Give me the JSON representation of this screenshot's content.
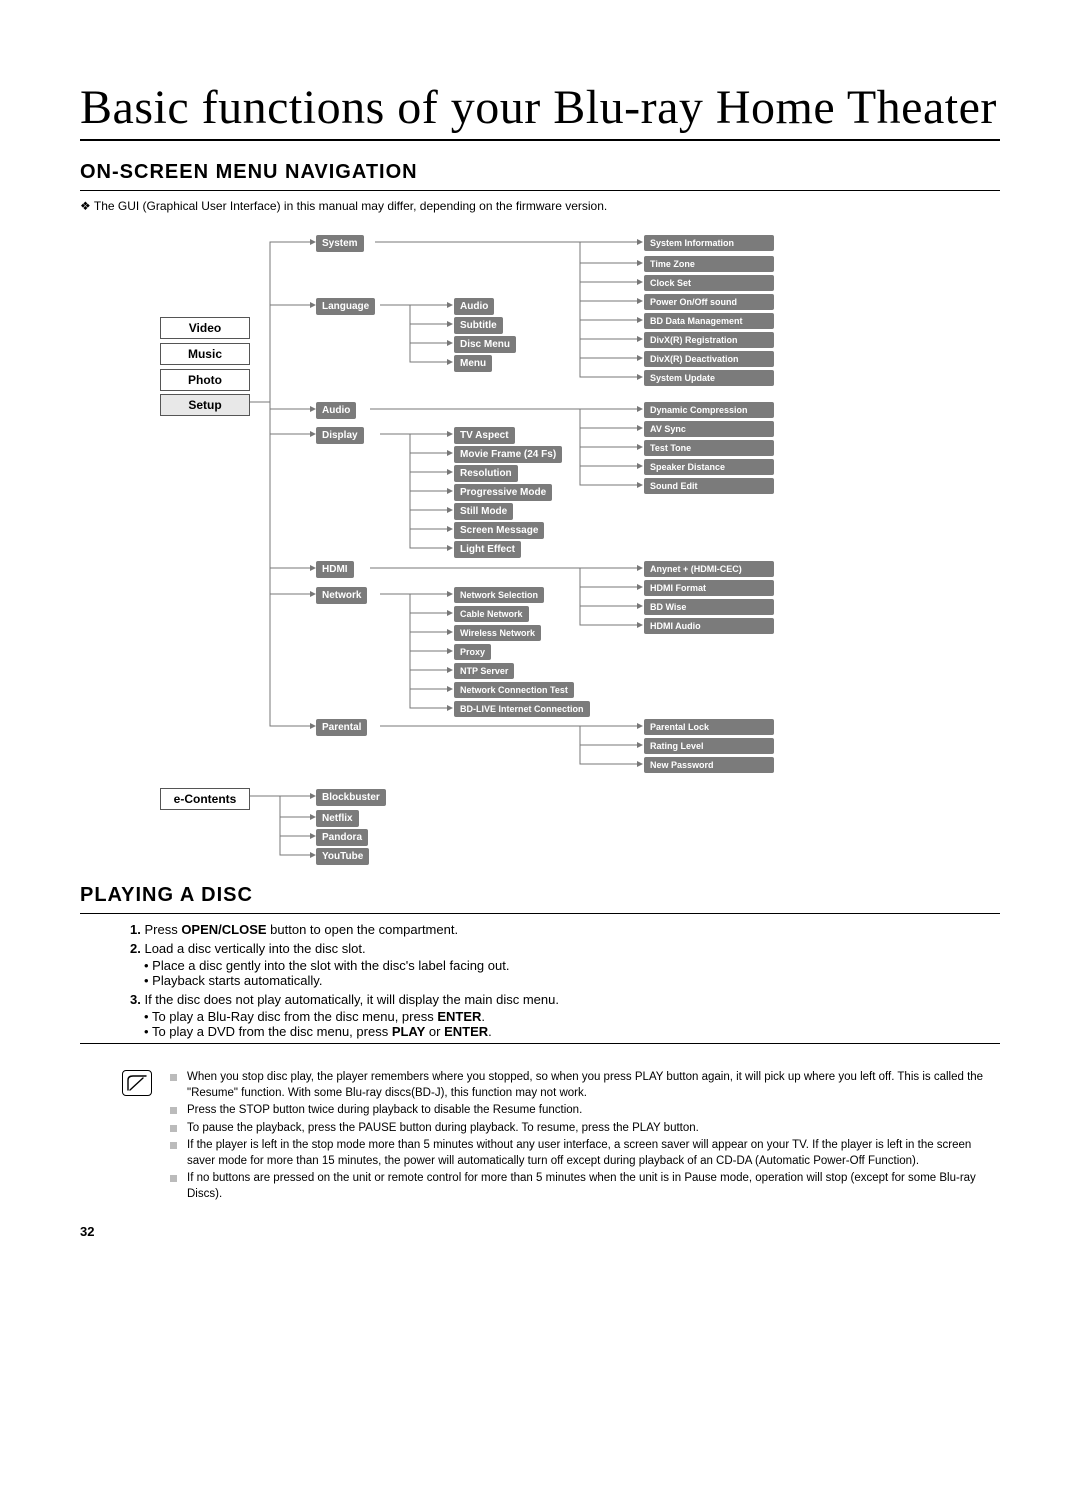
{
  "page_number": "32",
  "title": "Basic functions of your Blu-ray Home Theater",
  "section_nav": {
    "heading": "ON-SCREEN MENU NAVIGATION",
    "note": "The GUI (Graphical User Interface) in this manual may differ, depending on the firmware version."
  },
  "menu": {
    "main": [
      "Video",
      "Music",
      "Photo",
      "Setup"
    ],
    "econtents_label": "e-Contents",
    "econtents": [
      "Blockbuster",
      "Netflix",
      "Pandora",
      "YouTube"
    ],
    "setup": {
      "system": {
        "label": "System",
        "children": [
          "System Information",
          "Time Zone",
          "Clock Set",
          "Power On/Off sound",
          "BD Data Management",
          "DivX(R) Registration",
          "DivX(R) Deactivation",
          "System Update"
        ]
      },
      "language": {
        "label": "Language",
        "children": [
          "Audio",
          "Subtitle",
          "Disc Menu",
          "Menu"
        ]
      },
      "audio": {
        "label": "Audio",
        "children": [
          "Dynamic Compression",
          "AV Sync",
          "Test Tone",
          "Speaker Distance",
          "Sound Edit"
        ]
      },
      "display": {
        "label": "Display",
        "children": [
          "TV Aspect",
          "Movie Frame (24 Fs)",
          "Resolution",
          "Progressive Mode",
          "Still Mode",
          "Screen Message",
          "Light Effect"
        ]
      },
      "hdmi": {
        "label": "HDMI",
        "children": [
          "Anynet + (HDMI-CEC)",
          "HDMI Format",
          "BD Wise",
          "HDMI Audio"
        ]
      },
      "network": {
        "label": "Network",
        "children": [
          "Network Selection",
          "Cable Network",
          "Wireless Network",
          "Proxy",
          "NTP Server",
          "Network Connection Test",
          "BD-LIVE Internet Connection"
        ]
      },
      "parental": {
        "label": "Parental",
        "children": [
          "Parental Lock",
          "Rating Level",
          "New Password"
        ]
      }
    }
  },
  "section_play": {
    "heading": "PLAYING A DISC",
    "steps": [
      {
        "n": "1.",
        "pre": "Press ",
        "bold": "OPEN/CLOSE",
        "post": " button to open the compartment."
      },
      {
        "n": "2.",
        "text": "Load a disc vertically into the disc slot.",
        "subs": [
          "Place a disc gently into the slot with the disc's label facing out.",
          "Playback starts automatically."
        ]
      },
      {
        "n": "3.",
        "text": "If the disc does not play automatically, it will display the main disc menu.",
        "subs_rich": [
          {
            "pre": "To play a Blu-Ray disc from the disc menu, press ",
            "bold": "ENTER",
            "post": "."
          },
          {
            "pre": "To play a DVD from the disc menu, press ",
            "bold": "PLAY",
            "mid": " or ",
            "bold2": "ENTER",
            "post": "."
          }
        ]
      }
    ],
    "tips": [
      "When you stop disc play, the player remembers where you stopped, so when you press PLAY button again, it will pick up where you left off. This is called the \"Resume\" function. With some Blu-ray discs(BD-J), this function may not work.",
      "Press the STOP button twice during playback to disable the Resume function.",
      "To pause the playback, press the PAUSE button during playback. To resume, press the PLAY button.",
      "If the player is left in the stop mode more than 5 minutes without any user interface, a screen saver will appear on your TV. If the player is left in the screen saver mode for more than 15 minutes, the power will automatically turn off except during playback of an CD-DA (Automatic Power-Off Function).",
      "If no buttons are pressed on the unit or remote control for more than 5 minutes when the unit is in Pause mode, operation will stop (except for some Blu-ray Discs)."
    ]
  }
}
